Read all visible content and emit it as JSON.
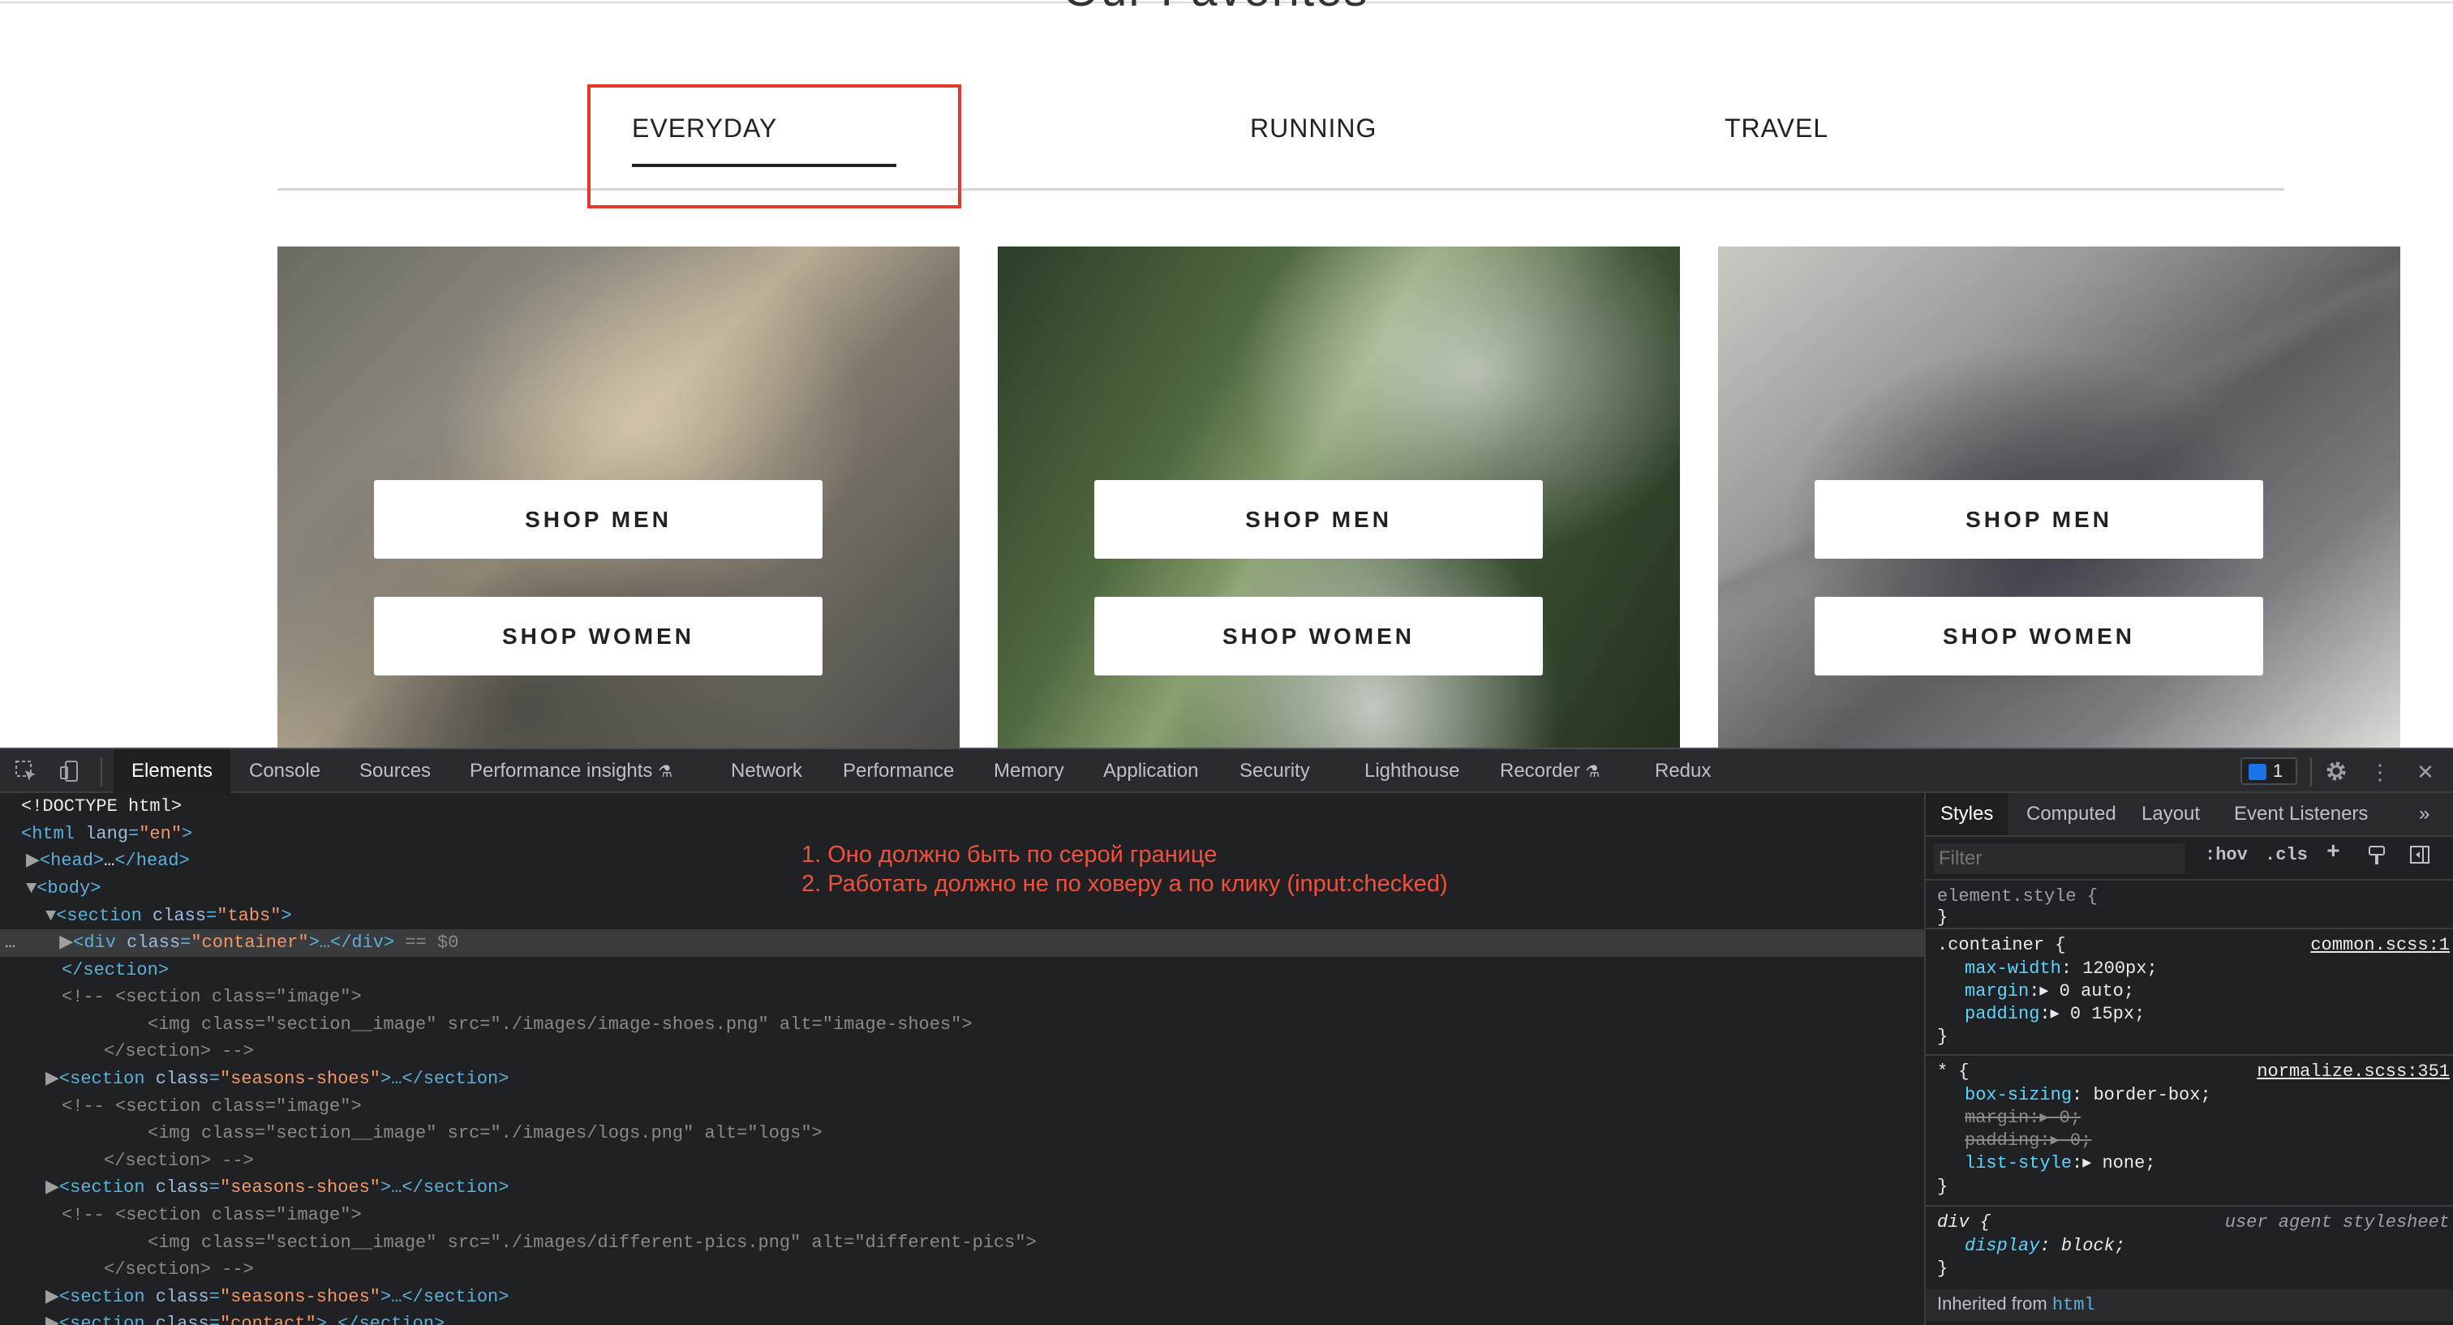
{
  "page": {
    "heading_fragment": "Our Favorites",
    "tabs": [
      "EVERYDAY",
      "RUNNING",
      "TRAVEL"
    ],
    "active_tab": "EVERYDAY",
    "cards": [
      {
        "image_desc": "shoes-everyday",
        "men_label": "SHOP MEN",
        "women_label": "SHOP WOMEN"
      },
      {
        "image_desc": "shoes-running",
        "men_label": "SHOP MEN",
        "women_label": "SHOP WOMEN"
      },
      {
        "image_desc": "shoes-travel",
        "men_label": "SHOP MEN",
        "women_label": "SHOP WOMEN"
      }
    ],
    "accent_color": "#e53a2b"
  },
  "devtools": {
    "tabs": [
      "Elements",
      "Console",
      "Sources",
      "Performance insights",
      "Network",
      "Performance",
      "Memory",
      "Application",
      "Security",
      "Lighthouse",
      "Recorder",
      "Redux"
    ],
    "active_tab": "Elements",
    "issues_count": "1",
    "annotation": {
      "line1": "1. Оно должно быть по серой границе",
      "line2": "2. Работать должно не по ховеру а по клику (input:checked)"
    },
    "dom": {
      "doctype": "<!DOCTYPE html>",
      "html_open": {
        "tag": "<html",
        "attr": "lang",
        "val": "\"en\"",
        "end": ">"
      },
      "head": {
        "tag": "<head>",
        "ellipsis": "…",
        "close": "</head>"
      },
      "body": "<body>",
      "section_tabs": {
        "tag": "<section",
        "attr": "class",
        "val": "\"tabs\"",
        "end": ">"
      },
      "div_container": {
        "tag": "<div",
        "attr": "class",
        "val": "\"container\"",
        "end": ">…</div>",
        "marker": " == $0"
      },
      "section_close": "</section>",
      "comment_blocks": [
        {
          "open": "<!-- <section class=\"image\">",
          "img": "<img class=\"section__image\" src=\"./images/image-shoes.png\" alt=\"image-shoes\">",
          "close": "</section> -->"
        },
        {
          "open": "<!-- <section class=\"image\">",
          "img": "<img class=\"section__image\" src=\"./images/logs.png\" alt=\"logs\">",
          "close": "</section> -->"
        },
        {
          "open": "<!-- <section class=\"image\">",
          "img": "<img class=\"section__image\" src=\"./images/different-pics.png\" alt=\"different-pics\">",
          "close": "</section> -->"
        }
      ],
      "seasons": {
        "tag": "<section",
        "attr": "class",
        "val": "\"seasons-shoes\"",
        "end": ">…</section>"
      },
      "contact": {
        "tag": "<section",
        "attr": "class",
        "val": "\"contact\"",
        "end": ">…</section>"
      }
    },
    "styles_panel": {
      "tabs": [
        "Styles",
        "Computed",
        "Layout",
        "Event Listeners"
      ],
      "active_tab": "Styles",
      "filter_placeholder": "Filter",
      "hov": ":hov",
      "cls": ".cls",
      "rules": {
        "element_style": {
          "selector": "element.style {",
          "close": "}"
        },
        "container": {
          "selector": ".container {",
          "source": "common.scss:1",
          "props": [
            {
              "name": "max-width",
              "value": "1200px;"
            },
            {
              "name": "margin",
              "value": "0 auto;"
            },
            {
              "name": "padding",
              "value": "0 15px;"
            }
          ],
          "close": "}"
        },
        "universal": {
          "selector": "* {",
          "source": "normalize.scss:351",
          "props": [
            {
              "name": "box-sizing",
              "value": "border-box;"
            },
            {
              "name": "margin",
              "value": "0;"
            },
            {
              "name": "padding",
              "value": "0;"
            },
            {
              "name": "list-style",
              "value": "none;"
            }
          ],
          "close": "}"
        },
        "div": {
          "selector": "div {",
          "source": "user agent stylesheet",
          "props": [
            {
              "name": "display",
              "value": "block;"
            }
          ],
          "close": "}"
        }
      },
      "inherited_label": "Inherited from",
      "inherited_tag": "html"
    }
  }
}
